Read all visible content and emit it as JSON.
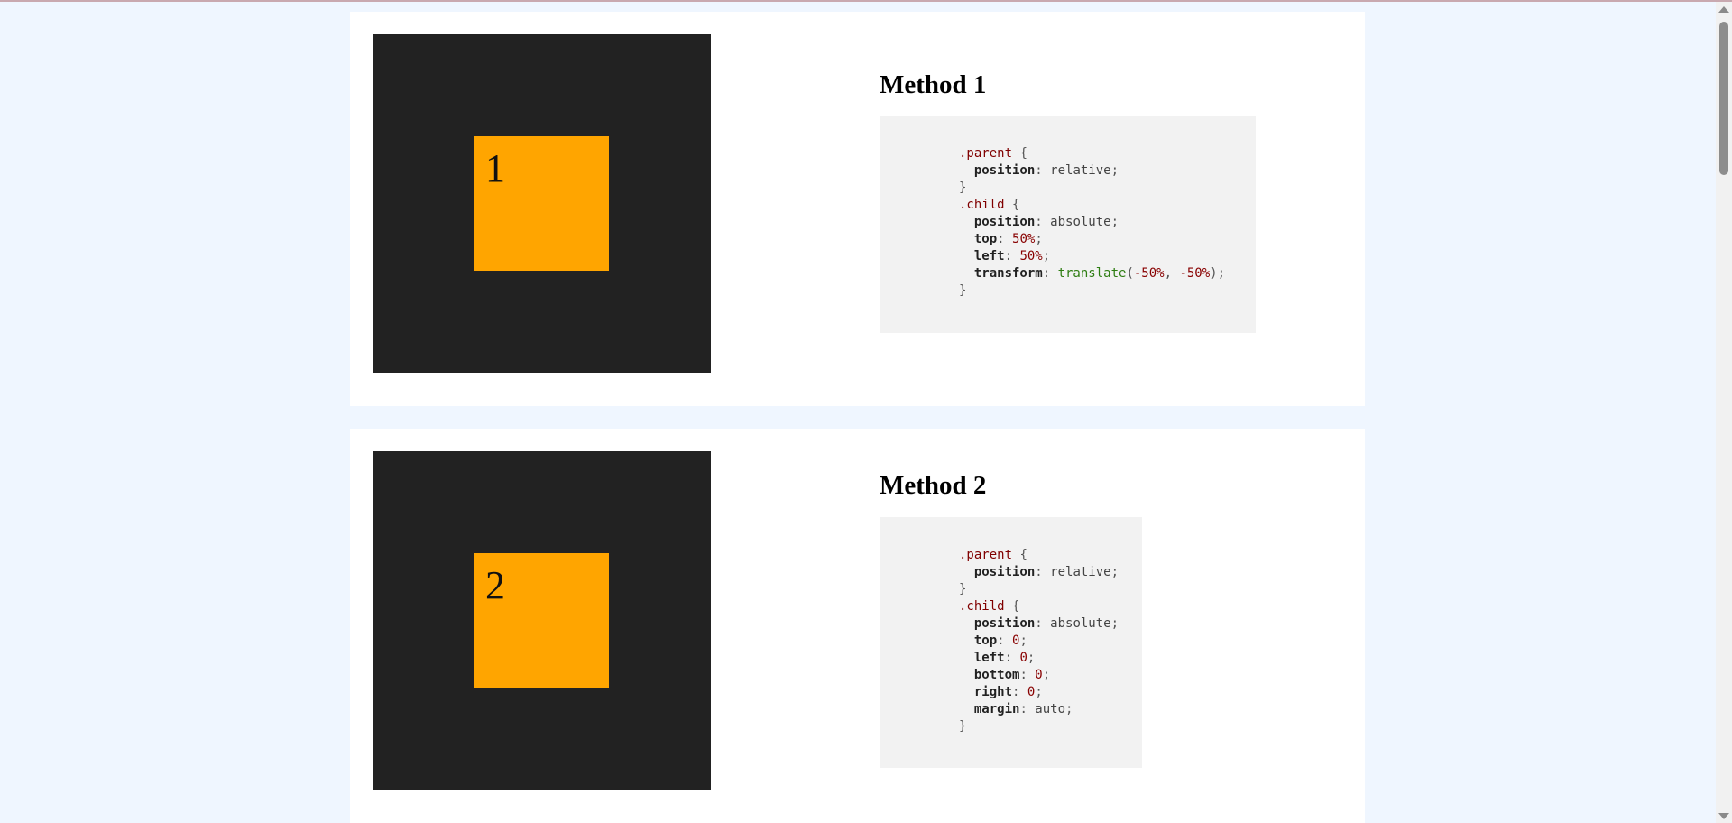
{
  "methods": [
    {
      "number": "1",
      "title": "Method 1",
      "code": [
        [
          {
            "t": ".parent",
            "c": "sel"
          },
          {
            "t": " {",
            "c": "brace"
          }
        ],
        [
          {
            "t": "  "
          },
          {
            "t": "position",
            "c": "prop"
          },
          {
            "t": ": ",
            "c": "brace"
          },
          {
            "t": "relative",
            "c": "val"
          },
          {
            "t": ";",
            "c": "brace"
          }
        ],
        [
          {
            "t": "}",
            "c": "brace"
          }
        ],
        [
          {
            "t": ".child",
            "c": "sel"
          },
          {
            "t": " {",
            "c": "brace"
          }
        ],
        [
          {
            "t": "  "
          },
          {
            "t": "position",
            "c": "prop"
          },
          {
            "t": ": ",
            "c": "brace"
          },
          {
            "t": "absolute",
            "c": "val"
          },
          {
            "t": ";",
            "c": "brace"
          }
        ],
        [
          {
            "t": "  "
          },
          {
            "t": "top",
            "c": "prop"
          },
          {
            "t": ": ",
            "c": "brace"
          },
          {
            "t": "50%",
            "c": "num"
          },
          {
            "t": ";",
            "c": "brace"
          }
        ],
        [
          {
            "t": "  "
          },
          {
            "t": "left",
            "c": "prop"
          },
          {
            "t": ": ",
            "c": "brace"
          },
          {
            "t": "50%",
            "c": "num"
          },
          {
            "t": ";",
            "c": "brace"
          }
        ],
        [
          {
            "t": "  "
          },
          {
            "t": "transform",
            "c": "prop"
          },
          {
            "t": ": ",
            "c": "brace"
          },
          {
            "t": "translate",
            "c": "fn"
          },
          {
            "t": "(",
            "c": "brace"
          },
          {
            "t": "-50%",
            "c": "num"
          },
          {
            "t": ", ",
            "c": "brace"
          },
          {
            "t": "-50%",
            "c": "num"
          },
          {
            "t": ");",
            "c": "brace"
          }
        ],
        [
          {
            "t": "}",
            "c": "brace"
          }
        ]
      ]
    },
    {
      "number": "2",
      "title": "Method 2",
      "code": [
        [
          {
            "t": ".parent",
            "c": "sel"
          },
          {
            "t": " {",
            "c": "brace"
          }
        ],
        [
          {
            "t": "  "
          },
          {
            "t": "position",
            "c": "prop"
          },
          {
            "t": ": ",
            "c": "brace"
          },
          {
            "t": "relative",
            "c": "val"
          },
          {
            "t": ";",
            "c": "brace"
          }
        ],
        [
          {
            "t": "}",
            "c": "brace"
          }
        ],
        [
          {
            "t": ".child",
            "c": "sel"
          },
          {
            "t": " {",
            "c": "brace"
          }
        ],
        [
          {
            "t": "  "
          },
          {
            "t": "position",
            "c": "prop"
          },
          {
            "t": ": ",
            "c": "brace"
          },
          {
            "t": "absolute",
            "c": "val"
          },
          {
            "t": ";",
            "c": "brace"
          }
        ],
        [
          {
            "t": "  "
          },
          {
            "t": "top",
            "c": "prop"
          },
          {
            "t": ": ",
            "c": "brace"
          },
          {
            "t": "0",
            "c": "num"
          },
          {
            "t": ";",
            "c": "brace"
          }
        ],
        [
          {
            "t": "  "
          },
          {
            "t": "left",
            "c": "prop"
          },
          {
            "t": ": ",
            "c": "brace"
          },
          {
            "t": "0",
            "c": "num"
          },
          {
            "t": ";",
            "c": "brace"
          }
        ],
        [
          {
            "t": "  "
          },
          {
            "t": "bottom",
            "c": "prop"
          },
          {
            "t": ": ",
            "c": "brace"
          },
          {
            "t": "0",
            "c": "num"
          },
          {
            "t": ";",
            "c": "brace"
          }
        ],
        [
          {
            "t": "  "
          },
          {
            "t": "right",
            "c": "prop"
          },
          {
            "t": ": ",
            "c": "brace"
          },
          {
            "t": "0",
            "c": "num"
          },
          {
            "t": ";",
            "c": "brace"
          }
        ],
        [
          {
            "t": "  "
          },
          {
            "t": "margin",
            "c": "prop"
          },
          {
            "t": ": ",
            "c": "brace"
          },
          {
            "t": "auto",
            "c": "val"
          },
          {
            "t": ";",
            "c": "brace"
          }
        ],
        [
          {
            "t": "}",
            "c": "brace"
          }
        ]
      ]
    }
  ],
  "colors": {
    "page_background": "#eff6ff",
    "card_background": "#ffffff",
    "parent_box": "#222222",
    "child_box": "#ffa500",
    "code_background": "#f2f2f2"
  },
  "icons": {
    "scroll_up": "triangle-up-icon",
    "scroll_down": "triangle-down-icon"
  }
}
